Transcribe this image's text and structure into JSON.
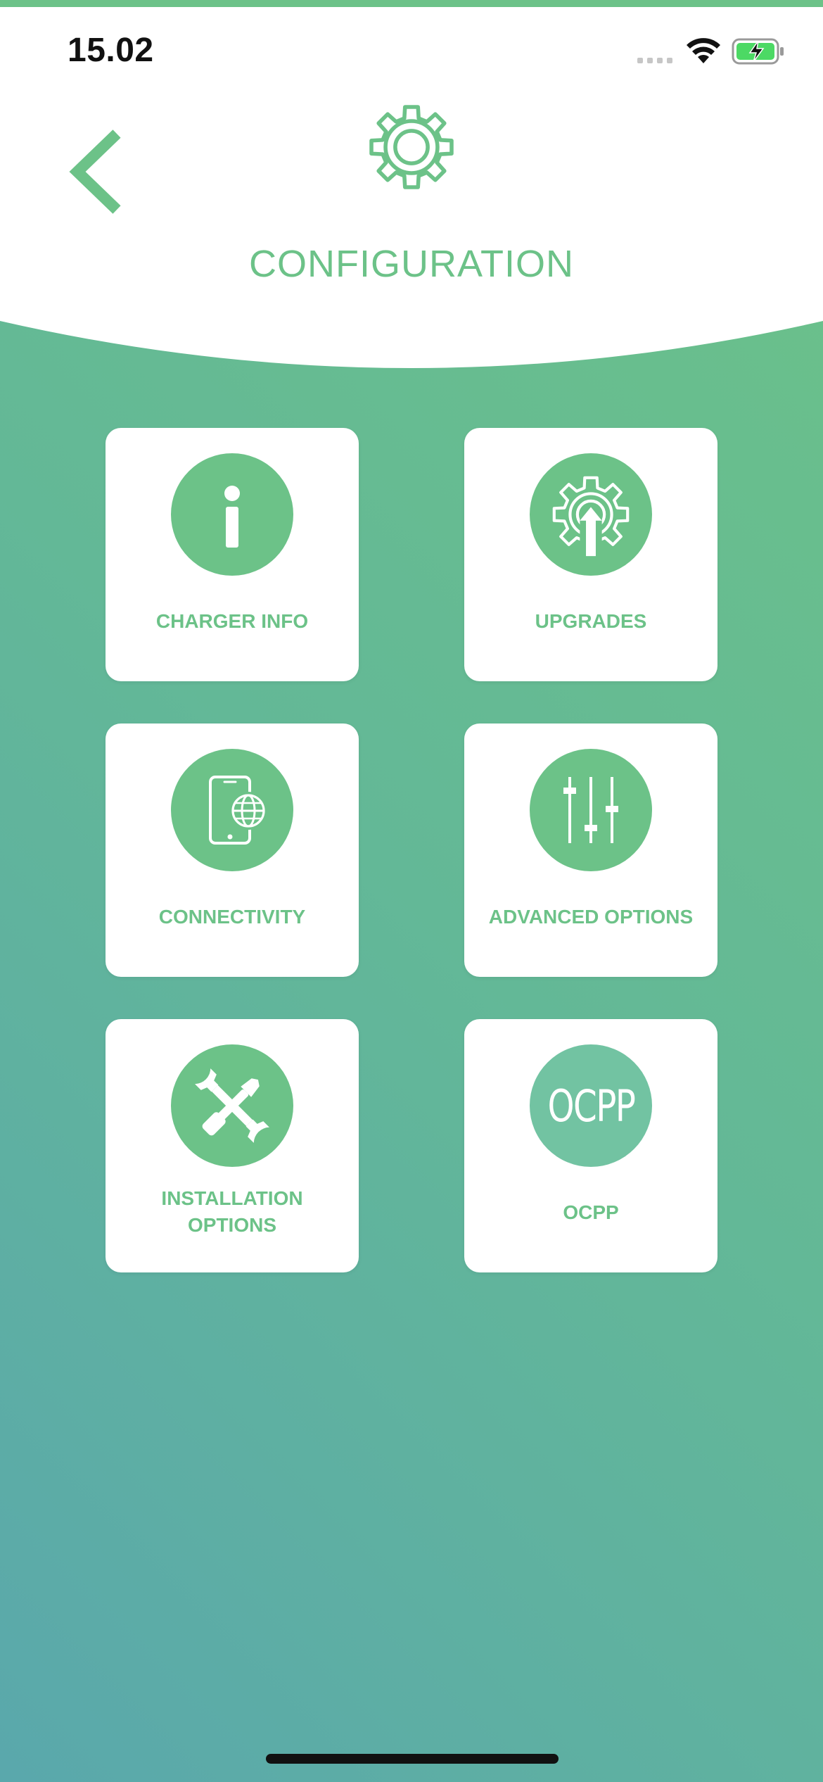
{
  "status_bar": {
    "time": "15.02",
    "wifi_icon": "wifi-icon",
    "battery_icon": "battery-charging-icon"
  },
  "header": {
    "title": "CONFIGURATION",
    "back_icon": "chevron-left-icon",
    "header_icon": "gear-icon"
  },
  "colors": {
    "accent": "#6cc288",
    "gradient_top": "#6cc288",
    "gradient_bottom": "#5aa8ac",
    "card_bg": "#ffffff",
    "ocpp_icon_bg": "#72c3a2"
  },
  "menu": {
    "items": [
      {
        "label": "CHARGER INFO",
        "icon": "info-icon"
      },
      {
        "label": "UPGRADES",
        "icon": "gear-upgrade-icon"
      },
      {
        "label": "CONNECTIVITY",
        "icon": "phone-globe-icon"
      },
      {
        "label": "ADVANCED OPTIONS",
        "icon": "sliders-icon"
      },
      {
        "label_line1": "INSTALLATION",
        "label_line2": "OPTIONS",
        "icon": "tools-icon"
      },
      {
        "label": "OCPP",
        "icon": "ocpp-icon",
        "icon_text": "OCPP"
      }
    ]
  }
}
